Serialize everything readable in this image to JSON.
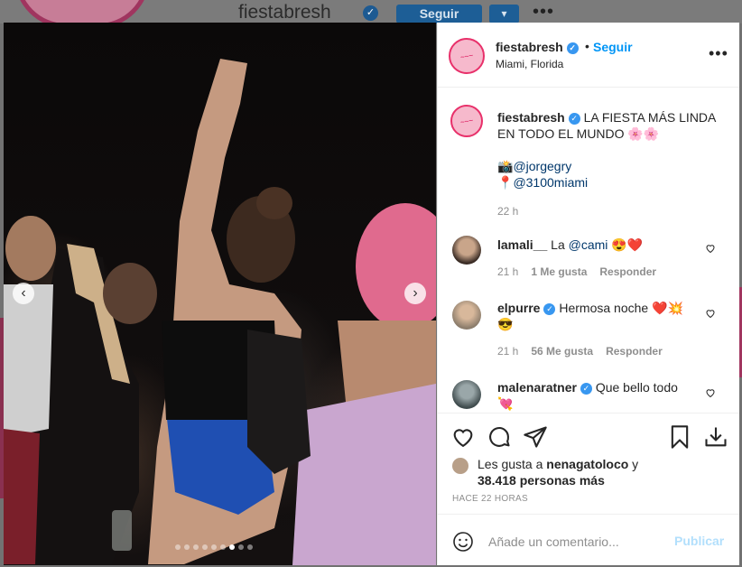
{
  "background": {
    "username": "fiestabresh",
    "follow_label": "Seguir",
    "dropdown_icon": "chevron-down-icon",
    "more_label": "•••"
  },
  "header": {
    "username": "fiestabresh",
    "verified": true,
    "separator": "•",
    "follow_label": "Seguir",
    "location": "Miami, Florida",
    "more_label": "•••"
  },
  "carousel": {
    "prev_label": "‹",
    "next_label": "›",
    "slide_count": 9,
    "active_index": 6
  },
  "caption": {
    "username": "fiestabresh",
    "text": "LA FIESTA MÁS LINDA EN TODO EL MUNDO 🌸🌸",
    "line_camera_icon": "📸",
    "line_camera_mention": "@jorgegry",
    "line_pin_icon": "📍",
    "line_pin_mention": "@3100miami",
    "time": "22 h"
  },
  "comments": [
    {
      "username": "lamali__",
      "verified": false,
      "text_prefix": "La ",
      "mention": "@cami",
      "text_suffix": " 😍❤️",
      "time": "21 h",
      "likes": "1 Me gusta",
      "reply_label": "Responder"
    },
    {
      "username": "elpurre",
      "verified": true,
      "text": "Hermosa noche ❤️💥😎",
      "time": "21 h",
      "likes": "56 Me gusta",
      "reply_label": "Responder"
    },
    {
      "username": "malenaratner",
      "verified": true,
      "text": "Que bello todo 💘"
    }
  ],
  "actions": {
    "likes_prefix": "Les gusta a ",
    "liked_by": "nenagatoloco",
    "likes_mid": " y",
    "likes_count": "38.418 personas más",
    "time_ago": "HACE 22 HORAS"
  },
  "add_comment": {
    "placeholder": "Añade un comentario...",
    "post_label": "Publicar"
  },
  "colors": {
    "accent": "#0095f6",
    "post_disabled": "#b2dffc",
    "brand_pink": "#e8306a"
  }
}
